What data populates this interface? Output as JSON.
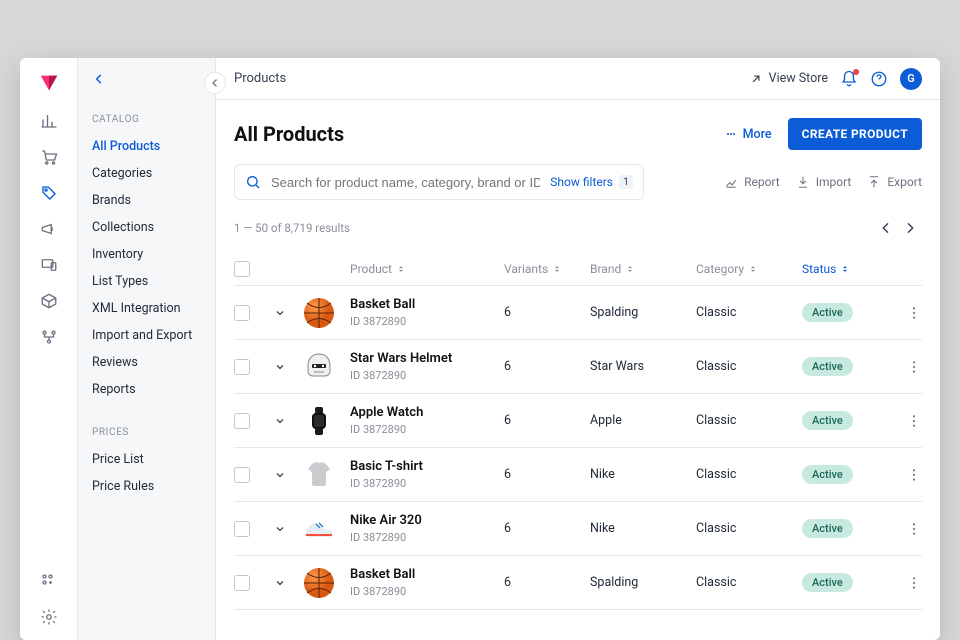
{
  "breadcrumb": "Products",
  "viewstore_label": "View Store",
  "avatar_letter": "G",
  "page_title": "All Products",
  "more_label": "More",
  "cta_label": "CREATE PRODUCT",
  "search": {
    "placeholder": "Search for product name, category, brand or ID"
  },
  "show_filters_label": "Show filters",
  "filter_count": "1",
  "actions": {
    "report": "Report",
    "import": "Import",
    "export": "Export"
  },
  "results_text": "1 — 50 of 8,719 results",
  "columns": {
    "product": "Product",
    "variants": "Variants",
    "brand": "Brand",
    "category": "Category",
    "status": "Status"
  },
  "sidebar": {
    "groups": [
      {
        "label": "CATALOG",
        "items": [
          "All Products",
          "Categories",
          "Brands",
          "Collections",
          "Inventory",
          "List Types",
          "XML Integration",
          "Import and Export",
          "Reviews",
          "Reports"
        ]
      },
      {
        "label": "PRICES",
        "items": [
          "Price List",
          "Price Rules"
        ]
      }
    ]
  },
  "rows": [
    {
      "name": "Basket Ball",
      "id": "ID 3872890",
      "variants": "6",
      "brand": "Spalding",
      "category": "Classic",
      "status": "Active",
      "thumb": "ball"
    },
    {
      "name": "Star Wars Helmet",
      "id": "ID 3872890",
      "variants": "6",
      "brand": "Star Wars",
      "category": "Classic",
      "status": "Active",
      "thumb": "helmet"
    },
    {
      "name": "Apple Watch",
      "id": "ID 3872890",
      "variants": "6",
      "brand": "Apple",
      "category": "Classic",
      "status": "Active",
      "thumb": "watch"
    },
    {
      "name": "Basic T-shirt",
      "id": "ID 3872890",
      "variants": "6",
      "brand": "Nike",
      "category": "Classic",
      "status": "Active",
      "thumb": "shirt"
    },
    {
      "name": "Nike Air 320",
      "id": "ID 3872890",
      "variants": "6",
      "brand": "Nike",
      "category": "Classic",
      "status": "Active",
      "thumb": "shoe"
    },
    {
      "name": "Basket Ball",
      "id": "ID 3872890",
      "variants": "6",
      "brand": "Spalding",
      "category": "Classic",
      "status": "Active",
      "thumb": "ball"
    }
  ]
}
